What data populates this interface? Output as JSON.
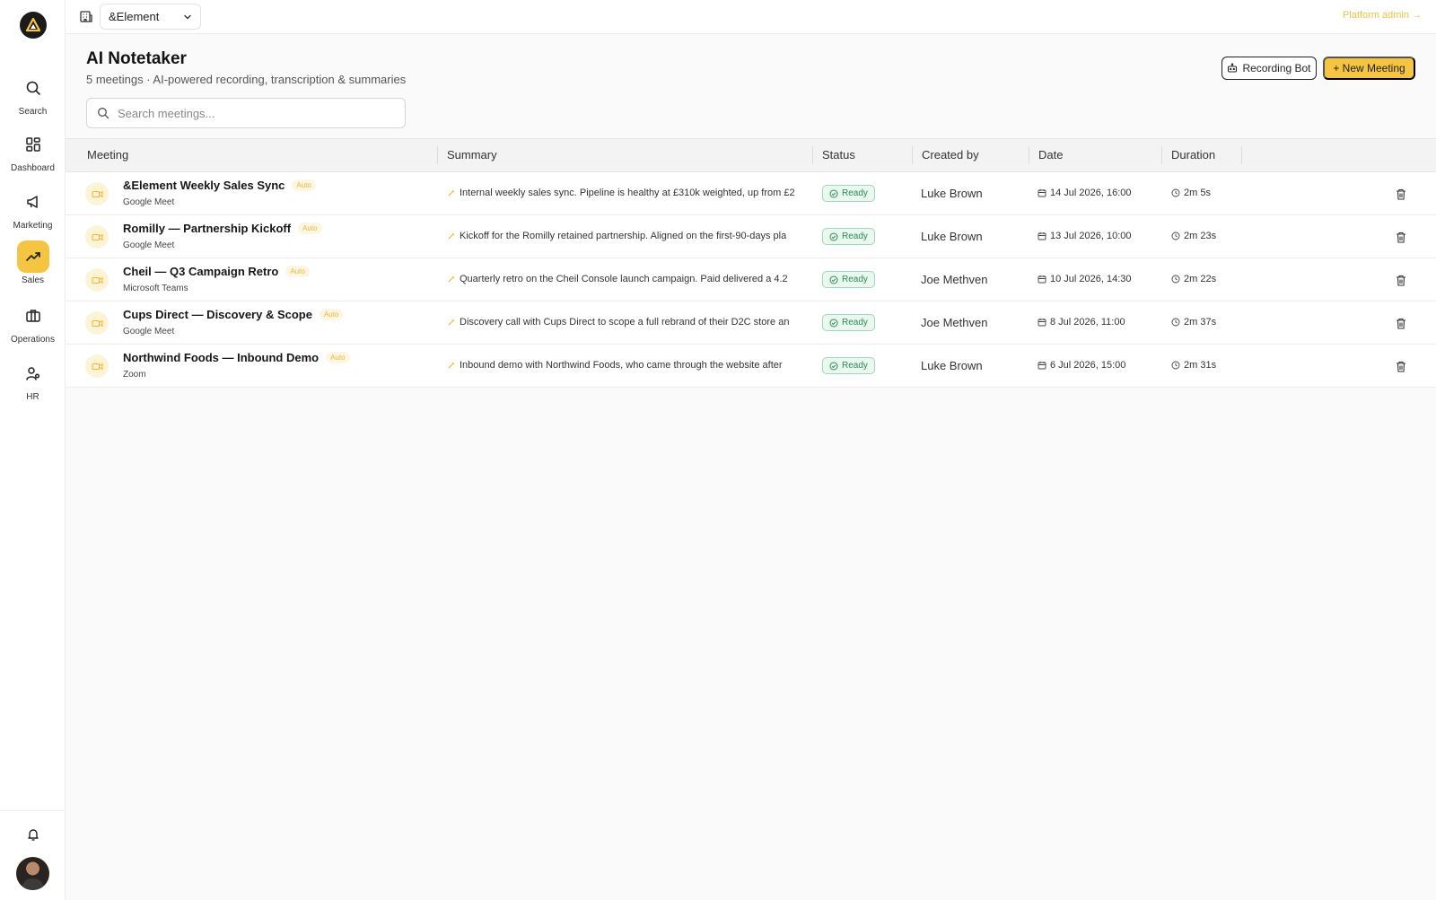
{
  "app": {
    "org_selector": "&Element",
    "platform_admin": "Platform admin →"
  },
  "sidebar": {
    "items": [
      {
        "label": "Search",
        "icon": "search-icon"
      },
      {
        "label": "Dashboard",
        "icon": "dashboard-icon"
      },
      {
        "label": "Marketing",
        "icon": "megaphone-icon"
      },
      {
        "label": "Sales",
        "icon": "trending-up-icon",
        "active": true
      },
      {
        "label": "Operations",
        "icon": "briefcase-icon"
      },
      {
        "label": "HR",
        "icon": "users-icon"
      }
    ]
  },
  "header": {
    "title": "AI Notetaker",
    "subtitle": "5 meetings · AI-powered recording, transcription & summaries",
    "recording_bot": "Recording Bot",
    "new_meeting": "+ New Meeting"
  },
  "search": {
    "placeholder": "Search meetings..."
  },
  "table": {
    "columns": [
      "Meeting",
      "Summary",
      "Status",
      "Created by",
      "Date",
      "Duration"
    ],
    "rows": [
      {
        "title": "&Element Weekly Sales Sync",
        "badge": "Auto",
        "platform": "Google Meet",
        "summary": "Internal weekly sales sync. Pipeline is healthy at £310k weighted, up from £2",
        "status": "Ready",
        "created_by": "Luke Brown",
        "date": "14 Jul 2026, 16:00",
        "duration": "2m 5s"
      },
      {
        "title": "Romilly — Partnership Kickoff",
        "badge": "Auto",
        "platform": "Google Meet",
        "summary": "Kickoff for the Romilly retained partnership. Aligned on the first-90-days pla",
        "status": "Ready",
        "created_by": "Luke Brown",
        "date": "13 Jul 2026, 10:00",
        "duration": "2m 23s"
      },
      {
        "title": "Cheil — Q3 Campaign Retro",
        "badge": "Auto",
        "platform": "Microsoft Teams",
        "summary": "Quarterly retro on the Cheil Console launch campaign. Paid delivered a 4.2",
        "status": "Ready",
        "created_by": "Joe Methven",
        "date": "10 Jul 2026, 14:30",
        "duration": "2m 22s"
      },
      {
        "title": "Cups Direct — Discovery & Scope",
        "badge": "Auto",
        "platform": "Google Meet",
        "summary": "Discovery call with Cups Direct to scope a full rebrand of their D2C store an",
        "status": "Ready",
        "created_by": "Joe Methven",
        "date": "8 Jul 2026, 11:00",
        "duration": "2m 37s"
      },
      {
        "title": "Northwind Foods — Inbound Demo",
        "badge": "Auto",
        "platform": "Zoom",
        "summary": "Inbound demo with Northwind Foods, who came through the website after",
        "status": "Ready",
        "created_by": "Luke Brown",
        "date": "6 Jul 2026, 15:00",
        "duration": "2m 31s"
      }
    ]
  },
  "colors": {
    "accent": "#f5c542",
    "status_green": "#2d8a55",
    "status_bg": "#eaf8ef"
  }
}
